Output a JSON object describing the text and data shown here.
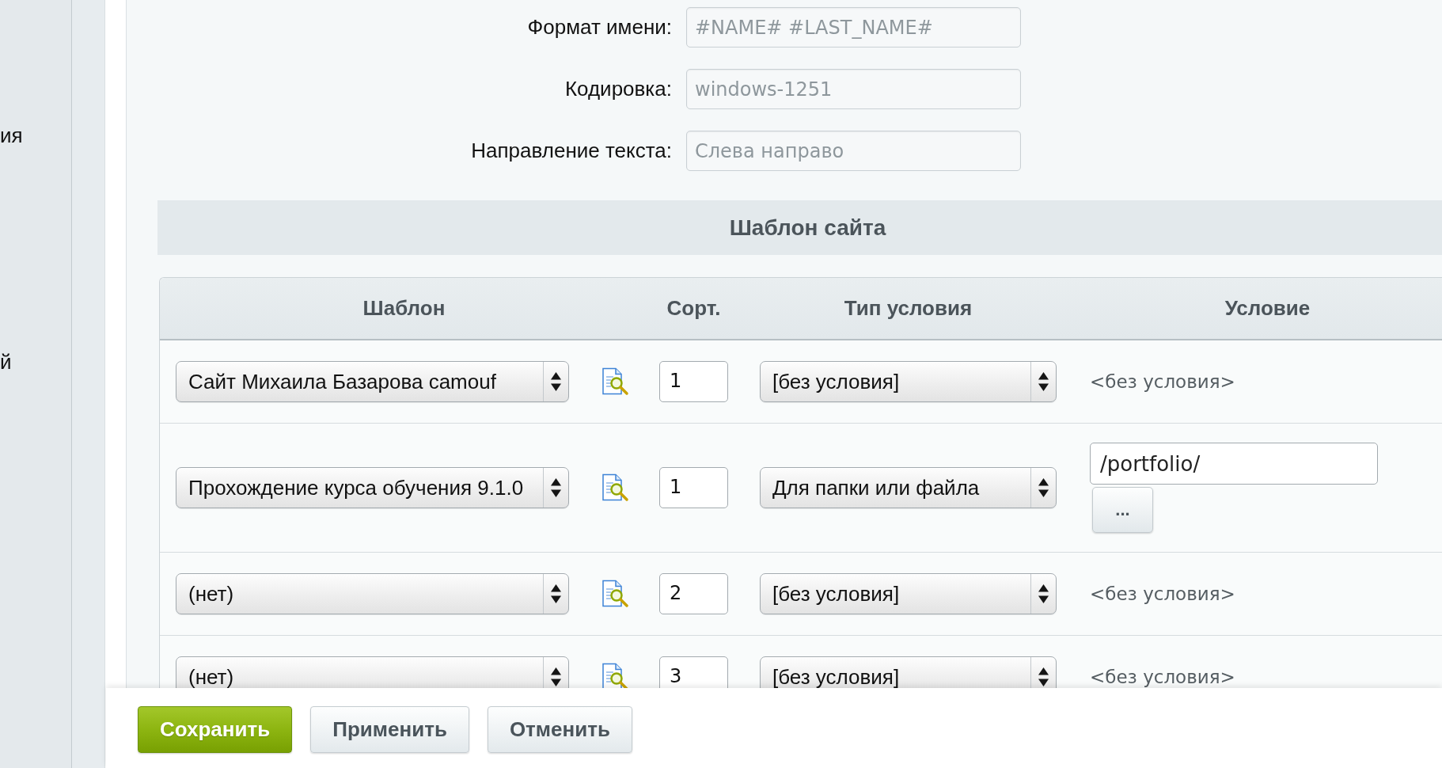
{
  "sidebar": {
    "items": [
      {
        "label": "ия"
      },
      {
        "label": "й"
      }
    ]
  },
  "settings": [
    {
      "label": "Формат имени:",
      "placeholder": "#NAME# #LAST_NAME#"
    },
    {
      "label": "Кодировка:",
      "placeholder": "windows-1251"
    },
    {
      "label": "Направление текста:",
      "placeholder": "Слева направо"
    }
  ],
  "template_section": {
    "title": "Шаблон сайта",
    "columns": [
      "Шаблон",
      "Сорт.",
      "Тип условия",
      "Условие"
    ],
    "rows": [
      {
        "template": "Сайт Михаила Базарова camouf",
        "sort": "1",
        "condition_type": "[без условия]",
        "condition": {
          "kind": "none",
          "text": "<без условия>"
        }
      },
      {
        "template": "Прохождение курса обучения 9.1.0",
        "sort": "1",
        "condition_type": "Для папки или файла",
        "condition": {
          "kind": "path",
          "value": "/portfolio/",
          "button": "..."
        }
      },
      {
        "template": "(нет)",
        "sort": "2",
        "condition_type": "[без условия]",
        "condition": {
          "kind": "none",
          "text": "<без условия>"
        }
      },
      {
        "template": "(нет)",
        "sort": "3",
        "condition_type": "[без условия]",
        "condition": {
          "kind": "none",
          "text": "<без условия>"
        }
      }
    ]
  },
  "buttons": [
    {
      "label": "Сохранить",
      "kind": "primary"
    },
    {
      "label": "Применить",
      "kind": "secondary"
    },
    {
      "label": "Отменить",
      "kind": "secondary"
    }
  ]
}
